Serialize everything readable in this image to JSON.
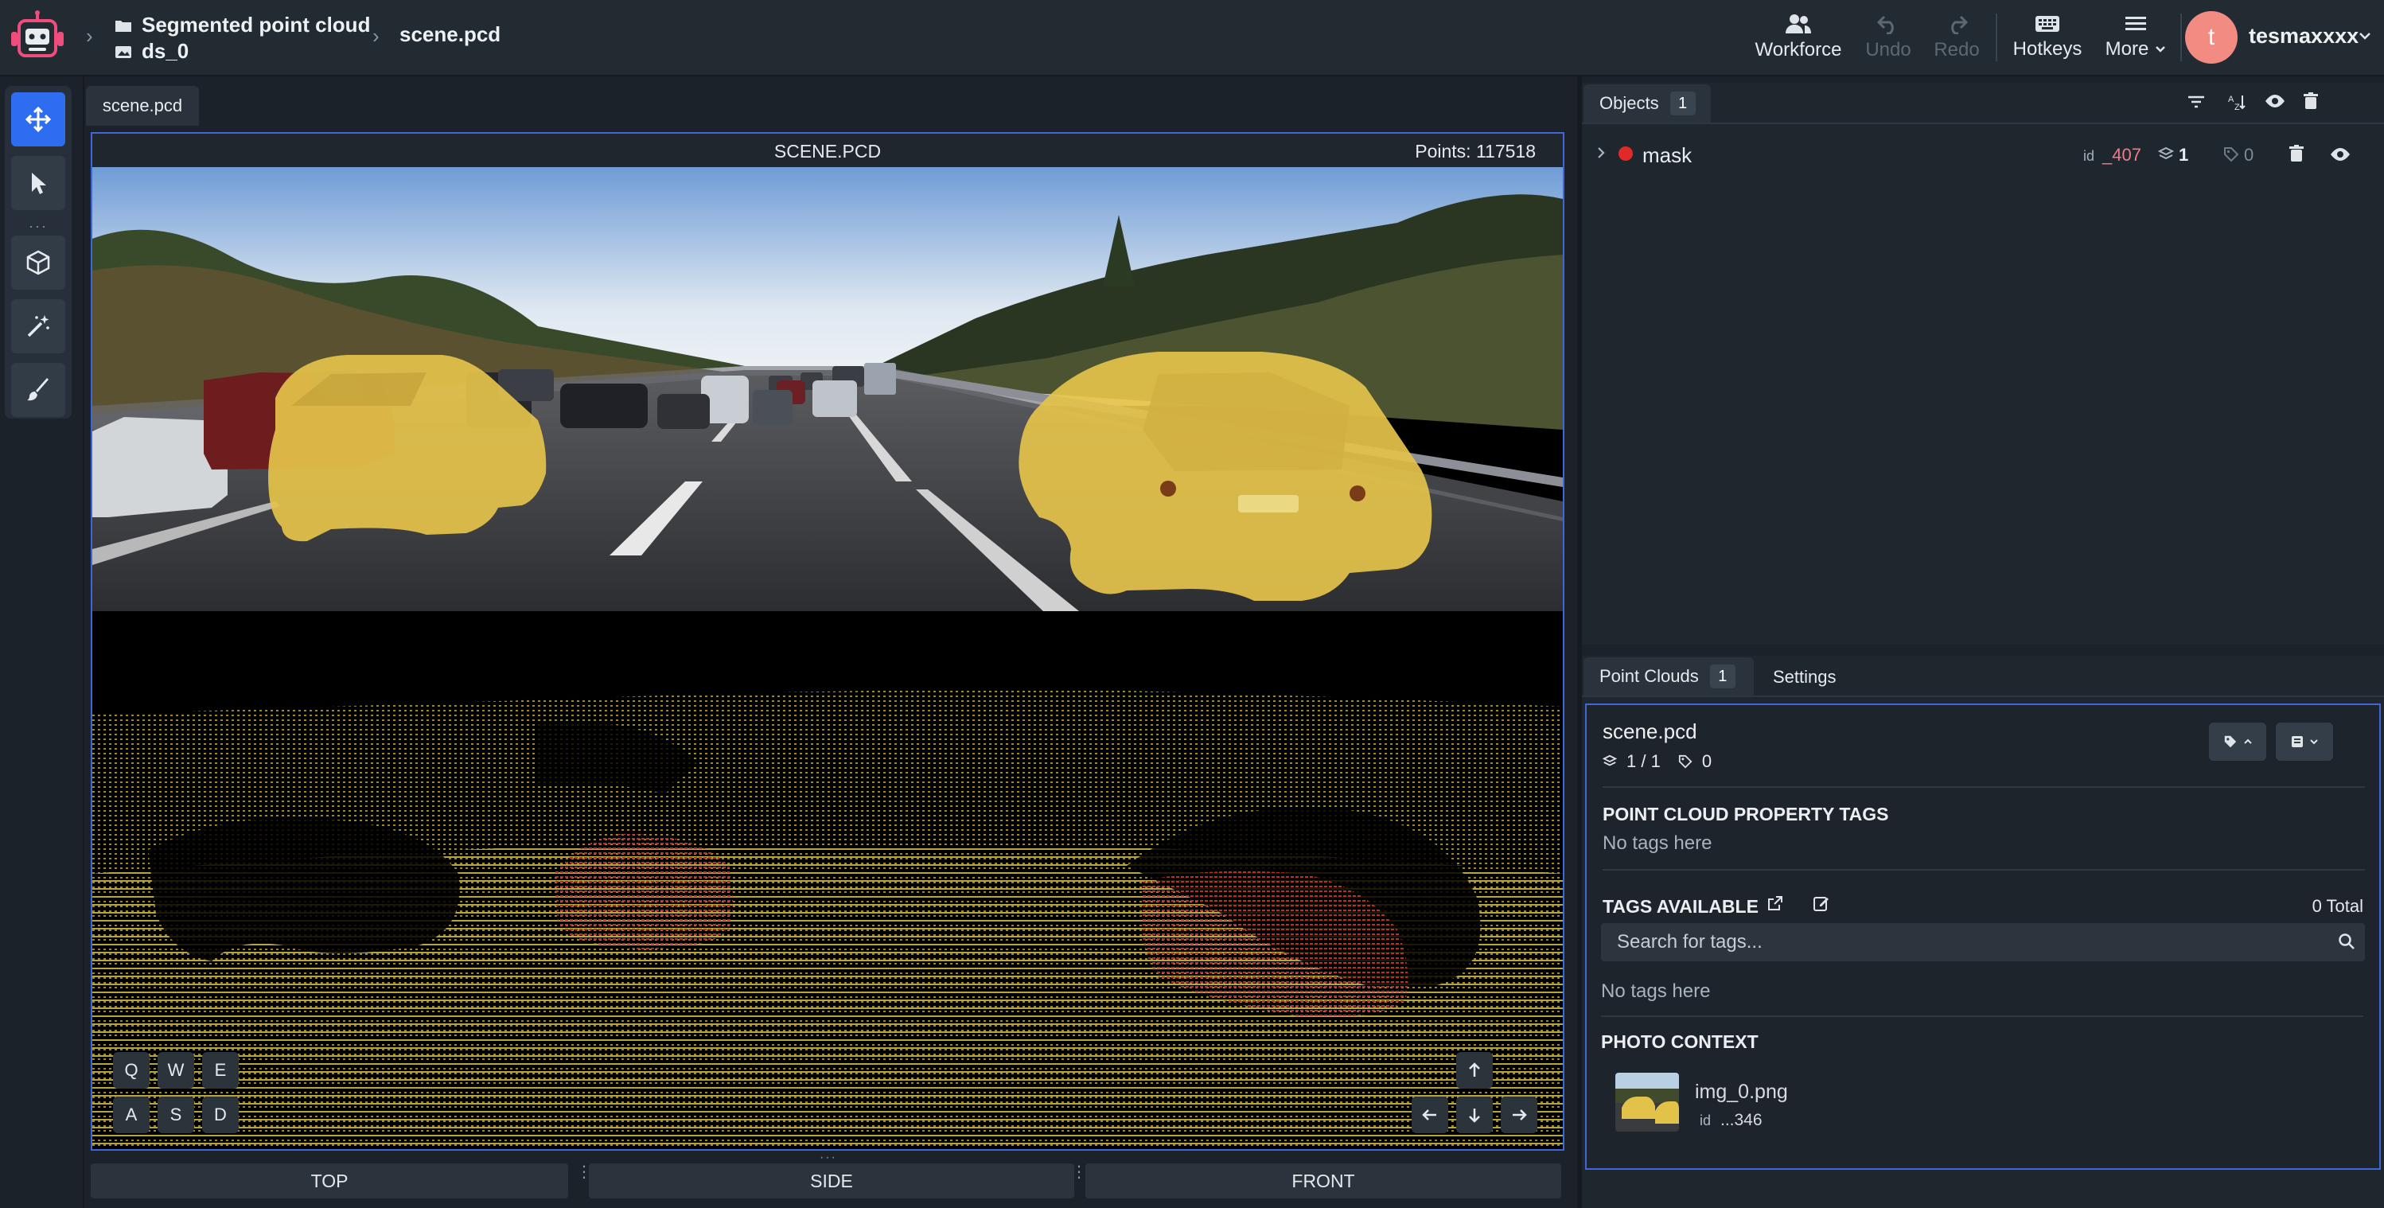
{
  "header": {
    "breadcrumb": {
      "project": "Segmented point cloud",
      "dataset": "ds_0",
      "file": "scene.pcd"
    },
    "actions": [
      {
        "label": "Workforce",
        "icon": "people-icon",
        "enabled": true
      },
      {
        "label": "Undo",
        "icon": "undo-icon",
        "enabled": false
      },
      {
        "label": "Redo",
        "icon": "redo-icon",
        "enabled": false
      },
      {
        "label": "Hotkeys",
        "icon": "keyboard-icon",
        "enabled": true
      },
      {
        "label": "More",
        "icon": "menu-icon",
        "enabled": true
      }
    ],
    "user": {
      "initial": "t",
      "name": "tesmaxxxx",
      "avatar_color": "#f28b82"
    }
  },
  "tools": [
    "move-tool",
    "select-tool",
    "cuboid-tool",
    "magic-wand-tool",
    "brush-tool"
  ],
  "viewer": {
    "tab_label": "scene.pcd",
    "title": "SCENE.PCD",
    "points": "Points: 117518",
    "keys_top": [
      "Q",
      "W",
      "E"
    ],
    "keys_bottom": [
      "A",
      "S",
      "D"
    ],
    "views": [
      "TOP",
      "SIDE",
      "FRONT"
    ]
  },
  "objects": {
    "tab_label": "Objects",
    "count": "1",
    "items": [
      {
        "name": "mask",
        "color": "#e02a2a",
        "id": "_407",
        "layers": "1",
        "tags": "0"
      }
    ]
  },
  "point_clouds": {
    "tab_label": "Point Clouds",
    "count": "1",
    "settings_tab": "Settings",
    "file_name": "scene.pcd",
    "frame": "1 / 1",
    "tags_count": "0",
    "property_tags_title": "POINT CLOUD PROPERTY TAGS",
    "no_tags": "No tags here",
    "tags_available_title": "TAGS AVAILABLE",
    "total": "0 Total",
    "search_placeholder": "Search for tags...",
    "no_tags_2": "No tags here",
    "photo_context_title": "PHOTO CONTEXT",
    "photo": {
      "name": "img_0.png",
      "id_label": "id",
      "id": "...346"
    }
  },
  "colors": {
    "accent": "#2e6cf0",
    "mask": "#e02a2a",
    "highlight_outline": "#3f67d8"
  }
}
